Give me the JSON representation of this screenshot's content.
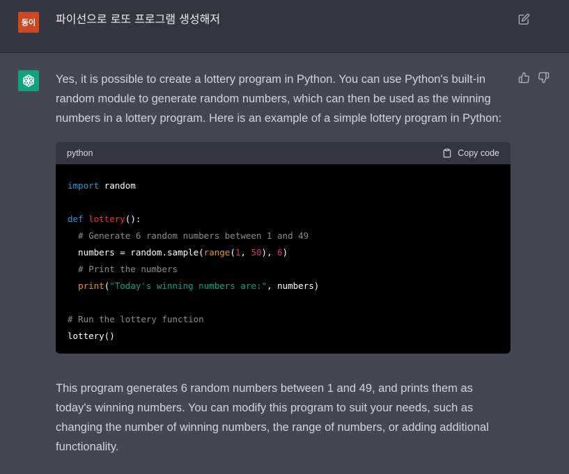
{
  "user": {
    "avatar_text": "동이",
    "message": "파이선으로 로또 프로그램 생성해저"
  },
  "assistant": {
    "intro": "Yes, it is possible to create a lottery program in Python. You can use Python's built-in random module to generate random numbers, which can then be used as the winning numbers in a lottery program. Here is an example of a simple lottery program in Python:",
    "outro": "This program generates 6 random numbers between 1 and 49, and prints them as today's winning numbers. You can modify this program to suit your needs, such as changing the number of winning numbers, the range of numbers, or adding additional functionality."
  },
  "code_block": {
    "language": "python",
    "copy_label": "Copy code",
    "lines": {
      "l1_kw": "import",
      "l1_rest": " random",
      "l3_kw": "def",
      "l3_fn": "lottery",
      "l3_rest": "():",
      "l4": "  # Generate 6 random numbers between 1 and 49",
      "l5_a": "  numbers = random.sample(",
      "l5_range": "range",
      "l5_b": "(",
      "l5_n1": "1",
      "l5_c": ", ",
      "l5_n2": "50",
      "l5_d": "), ",
      "l5_n3": "6",
      "l5_e": ")",
      "l6": "  # Print the numbers",
      "l7_print": "print",
      "l7_a": "(",
      "l7_str": "\"Today's winning numbers are:\"",
      "l7_b": ", numbers)",
      "l9": "# Run the lottery function",
      "l10": "lottery()"
    }
  },
  "icons": {
    "edit": "edit-icon",
    "thumbs_up": "thumbs-up-icon",
    "thumbs_down": "thumbs-down-icon",
    "copy": "clipboard-icon",
    "assistant_logo": "openai-logo-icon"
  },
  "colors": {
    "user_bg": "#343541",
    "assistant_bg": "#444654",
    "user_avatar": "#cc4a1d",
    "assistant_avatar": "#10a37f",
    "code_bg": "#000000"
  }
}
